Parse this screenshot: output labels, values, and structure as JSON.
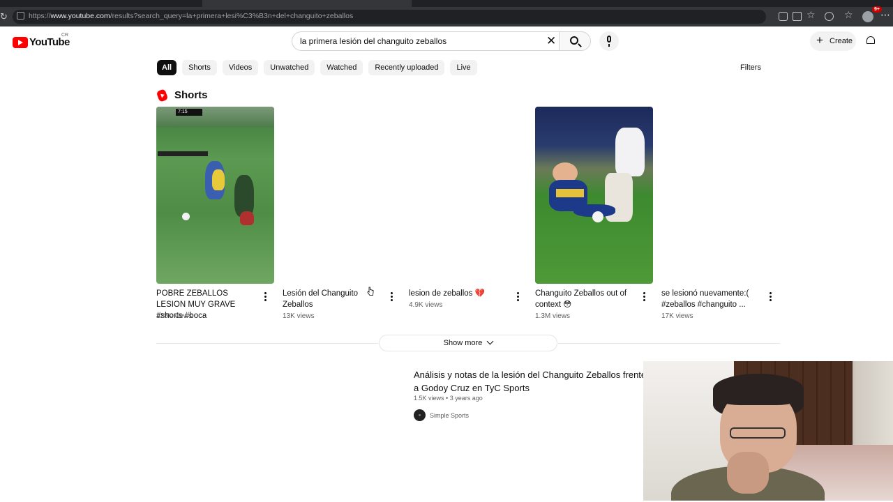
{
  "browser": {
    "url_prefix": "https://",
    "url_host": "www.youtube.com",
    "url_path": "/results?search_query=la+primera+lesi%C3%B3n+del+changuito+zeballos"
  },
  "header": {
    "logo_text": "YouTube",
    "country_code": "CR",
    "search_query": "la primera lesión del changuito zeballos",
    "create_label": "Create",
    "notification_badge": "9+"
  },
  "chips": {
    "items": [
      "All",
      "Shorts",
      "Videos",
      "Unwatched",
      "Watched",
      "Recently uploaded",
      "Live"
    ],
    "active": "All",
    "filters_label": "Filters"
  },
  "shorts": {
    "section_title": "Shorts",
    "items": [
      {
        "title": "POBRE ZEBALLOS LESION MUY GRAVE #shorts #boca",
        "views": "125K views",
        "timestamp": "7:15"
      },
      {
        "title": "Lesión del Changuito Zeballos",
        "views": "13K views"
      },
      {
        "title": "lesion de zeballos 💔",
        "views": "4.9K views"
      },
      {
        "title": "Changuito Zeballos out of context 😳",
        "views": "1.3M views"
      },
      {
        "title": "se lesionó nuevamente:( #zeballos #changuito ...",
        "views": "17K views"
      }
    ],
    "show_more_label": "Show more"
  },
  "video": {
    "title": "Análisis y notas de la lesión del Changuito Zeballos frente a Godoy Cruz en TyC Sports",
    "views": "1.5K views",
    "age": "3 years ago",
    "channel": "Simple Sports"
  },
  "colors": {
    "brand_red": "#ff0000",
    "chip_bg": "#f2f2f2",
    "chip_active_bg": "#0f0f0f",
    "secondary_text": "#606060"
  }
}
